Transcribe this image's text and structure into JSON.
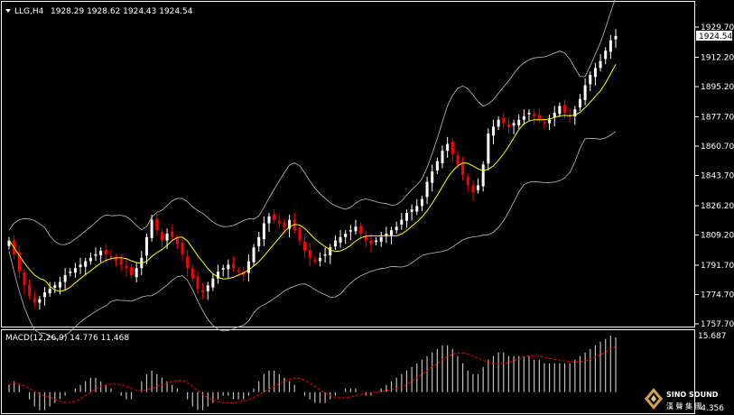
{
  "header": {
    "symbol": "LLG,H4",
    "ohlc": "1928.29 1928.62 1924.43 1924.54"
  },
  "price_axis": {
    "ticks": [
      "1929.70",
      "1912.20",
      "1895.20",
      "1877.70",
      "1860.70",
      "1843.70",
      "1826.20",
      "1809.20",
      "1791.70",
      "1774.70",
      "1757.70"
    ],
    "current_price_label": "1924.54"
  },
  "macd": {
    "label": "MACD(12,26,9) 14.776 11.468",
    "max_label": "15.687",
    "min_label": "-4.356"
  },
  "logo": {
    "brand_text": "SINO SOUND",
    "cn_text": "漢 聲 集 團"
  },
  "colors": {
    "background": "#000000",
    "bull": "#ffffff",
    "bear": "#ff0000",
    "ma": "#ffff00",
    "bands": "#c0c0c0",
    "macd_hist": "#c0c0c0",
    "macd_signal": "#ff0000"
  },
  "chart_data": {
    "type": "candlestick",
    "timeframe": "H4",
    "ylim": [
      1757.7,
      1931.0
    ],
    "closes": [
      1806,
      1798,
      1788,
      1780,
      1774,
      1770,
      1772,
      1776,
      1778,
      1780,
      1782,
      1786,
      1788,
      1790,
      1792,
      1794,
      1796,
      1798,
      1800,
      1798,
      1796,
      1794,
      1792,
      1790,
      1786,
      1790,
      1796,
      1808,
      1818,
      1812,
      1806,
      1810,
      1808,
      1804,
      1798,
      1790,
      1784,
      1778,
      1776,
      1780,
      1784,
      1788,
      1790,
      1792,
      1790,
      1788,
      1786,
      1794,
      1802,
      1808,
      1816,
      1820,
      1818,
      1816,
      1814,
      1818,
      1812,
      1806,
      1800,
      1796,
      1794,
      1796,
      1798,
      1802,
      1806,
      1808,
      1810,
      1812,
      1814,
      1810,
      1806,
      1804,
      1806,
      1808,
      1810,
      1812,
      1814,
      1818,
      1822,
      1824,
      1826,
      1830,
      1840,
      1846,
      1852,
      1858,
      1862,
      1856,
      1850,
      1844,
      1838,
      1834,
      1838,
      1850,
      1868,
      1872,
      1876,
      1874,
      1872,
      1874,
      1876,
      1878,
      1880,
      1878,
      1876,
      1874,
      1876,
      1880,
      1884,
      1880,
      1878,
      1882,
      1888,
      1896,
      1902,
      1906,
      1910,
      1916,
      1922,
      1924.54
    ],
    "ma_period_note": "",
    "macd_hist": [
      2,
      3,
      2,
      0,
      -2,
      -4,
      -5,
      -5,
      -4,
      -3,
      -2,
      -1,
      0,
      1,
      2,
      3,
      4,
      4,
      3,
      2,
      1,
      0,
      -1,
      -2,
      -2,
      0,
      3,
      5,
      6,
      5,
      4,
      3,
      2,
      1,
      0,
      -2,
      -4,
      -5,
      -5,
      -4,
      -3,
      -2,
      -1,
      -1,
      -2,
      -2,
      -2,
      -1,
      1,
      3,
      5,
      6,
      6,
      5,
      4,
      3,
      2,
      0,
      -1,
      -2,
      -3,
      -3,
      -3,
      -2,
      -1,
      0,
      1,
      1,
      1,
      0,
      -1,
      -1,
      0,
      1,
      2,
      3,
      4,
      5,
      6,
      7,
      8,
      9,
      10,
      11,
      12,
      13,
      13,
      12,
      10,
      8,
      6,
      5,
      5,
      7,
      9,
      10,
      11,
      11,
      10,
      10,
      10,
      10,
      10,
      9,
      9,
      8,
      8,
      8,
      8,
      8,
      8,
      9,
      10,
      11,
      12,
      13,
      14,
      14.776,
      15.687,
      15.2
    ]
  }
}
